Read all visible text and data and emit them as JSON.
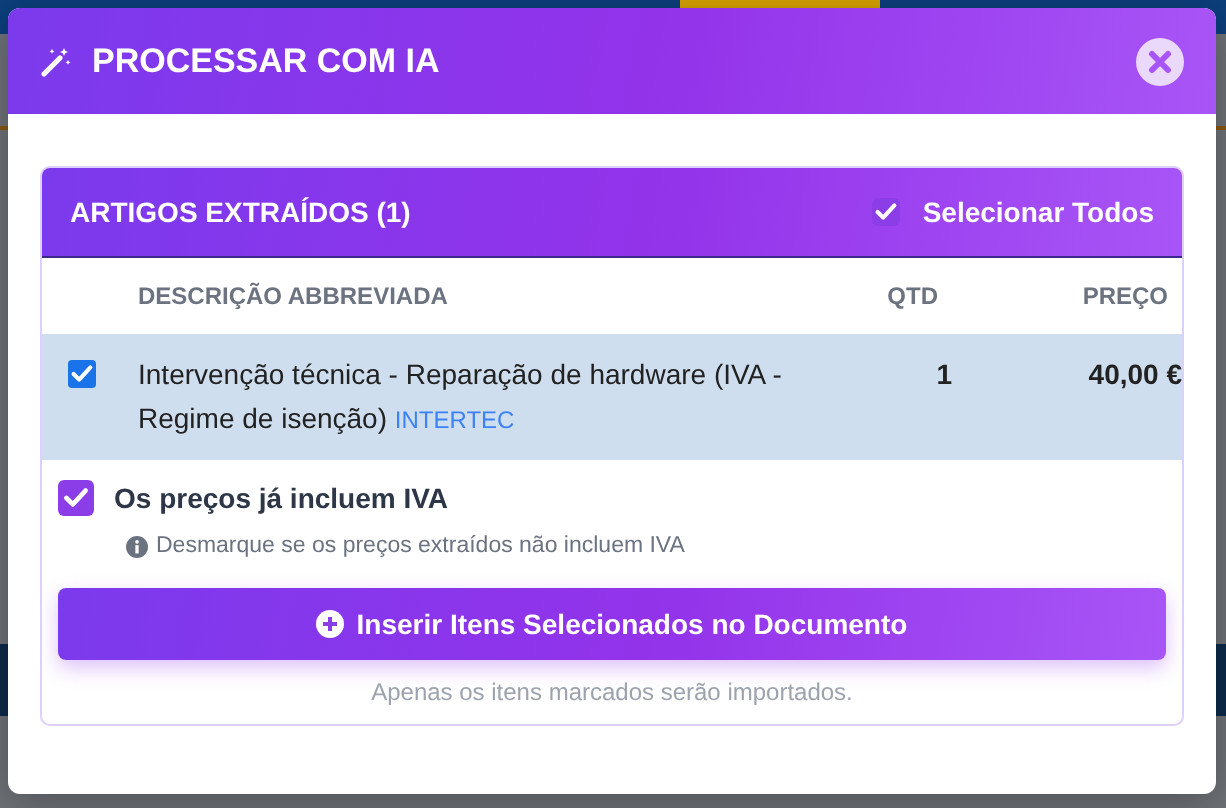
{
  "modal": {
    "title": "PROCESSAR COM IA",
    "card": {
      "title": "ARTIGOS EXTRAÍDOS (1)",
      "select_all": {
        "label": "Selecionar Todos",
        "checked": true
      },
      "columns": [
        "DESCRIÇÃO ABBREVIADA",
        "QTD",
        "PREÇO"
      ],
      "rows": [
        {
          "checked": true,
          "description": "Intervenção técnica - Reparação de hardware (IVA - Regime de isenção)",
          "tag": "INTERTEC",
          "qty": "1",
          "price": "40,00 €"
        }
      ],
      "vat_option": {
        "label": "Os preços já incluem IVA",
        "checked": true,
        "hint": "Desmarque se os preços extraídos não incluem IVA"
      },
      "insert_button": "Inserir Itens Selecionados no Documento",
      "note": "Apenas os itens marcados serão importados."
    }
  }
}
